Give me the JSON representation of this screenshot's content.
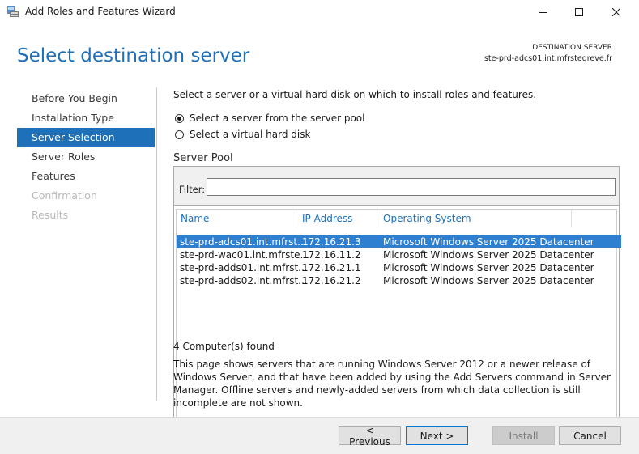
{
  "window": {
    "title": "Add Roles and Features Wizard"
  },
  "header": {
    "page_title": "Select destination server",
    "destination_label": "DESTINATION SERVER",
    "destination_value": "ste-prd-adcs01.int.mfrstegreve.fr"
  },
  "nav": {
    "items": [
      {
        "label": "Before You Begin",
        "state": "normal"
      },
      {
        "label": "Installation Type",
        "state": "normal"
      },
      {
        "label": "Server Selection",
        "state": "active"
      },
      {
        "label": "Server Roles",
        "state": "normal"
      },
      {
        "label": "Features",
        "state": "normal"
      },
      {
        "label": "Confirmation",
        "state": "disabled"
      },
      {
        "label": "Results",
        "state": "disabled"
      }
    ]
  },
  "content": {
    "instruction": "Select a server or a virtual hard disk on which to install roles and features.",
    "radio_server_pool": "Select a server from the server pool",
    "radio_vhd": "Select a virtual hard disk",
    "selected_option": "server_pool",
    "pool_title": "Server Pool",
    "filter_label": "Filter:",
    "filter_value": "",
    "columns": {
      "name": "Name",
      "ip": "IP Address",
      "os": "Operating System"
    },
    "rows": [
      {
        "name": "ste-prd-adcs01.int.mfrst...",
        "ip": "172.16.21.3",
        "os": "Microsoft Windows Server 2025 Datacenter",
        "selected": true
      },
      {
        "name": "ste-prd-wac01.int.mfrste...",
        "ip": "172.16.11.2",
        "os": "Microsoft Windows Server 2025 Datacenter",
        "selected": false
      },
      {
        "name": "ste-prd-adds01.int.mfrst...",
        "ip": "172.16.21.1",
        "os": "Microsoft Windows Server 2025 Datacenter",
        "selected": false
      },
      {
        "name": "ste-prd-adds02.int.mfrst...",
        "ip": "172.16.21.2",
        "os": "Microsoft Windows Server 2025 Datacenter",
        "selected": false
      }
    ],
    "count_text": "4 Computer(s) found",
    "description": "This page shows servers that are running Windows Server 2012 or a newer release of Windows Server, and that have been added by using the Add Servers command in Server Manager. Offline servers and newly-added servers from which data collection is still incomplete are not shown."
  },
  "footer": {
    "previous_label": "< Previous",
    "next_label": "Next >",
    "install_label": "Install",
    "cancel_label": "Cancel"
  },
  "colors": {
    "accent": "#1e70b9",
    "selection": "#2f7fd1",
    "footer_bg": "#f0f0f0"
  }
}
